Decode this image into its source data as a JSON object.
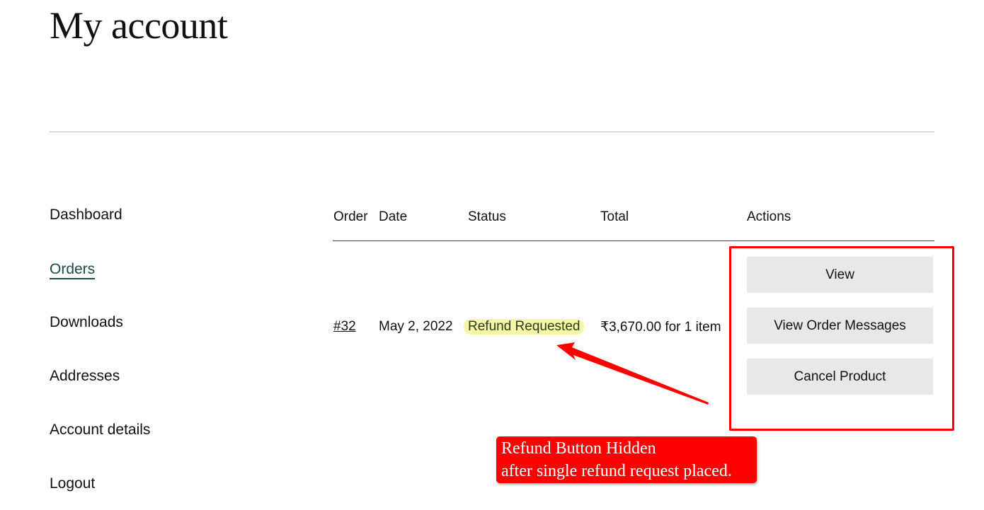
{
  "page": {
    "title": "My account"
  },
  "sidebar": {
    "items": [
      {
        "label": "Dashboard",
        "active": false
      },
      {
        "label": "Orders",
        "active": true
      },
      {
        "label": "Downloads",
        "active": false
      },
      {
        "label": "Addresses",
        "active": false
      },
      {
        "label": "Account details",
        "active": false
      },
      {
        "label": "Logout",
        "active": false
      }
    ]
  },
  "orders_table": {
    "headers": [
      "Order",
      "Date",
      "Status",
      "Total",
      "Actions"
    ],
    "rows": [
      {
        "order": "#32",
        "date": "May 2, 2022",
        "status": "Refund Requested",
        "total": "₹3,670.00 for 1 item",
        "actions": [
          "View",
          "View Order Messages",
          "Cancel Product"
        ]
      }
    ]
  },
  "annotation": {
    "callout_line1": "Refund Button Hidden",
    "callout_line2": "after single refund request placed.",
    "color": "#ff0000"
  },
  "colors": {
    "active_link": "#1d4b4b",
    "status_highlight": "#f6f6a6",
    "button_bg": "#e9e7ea"
  }
}
